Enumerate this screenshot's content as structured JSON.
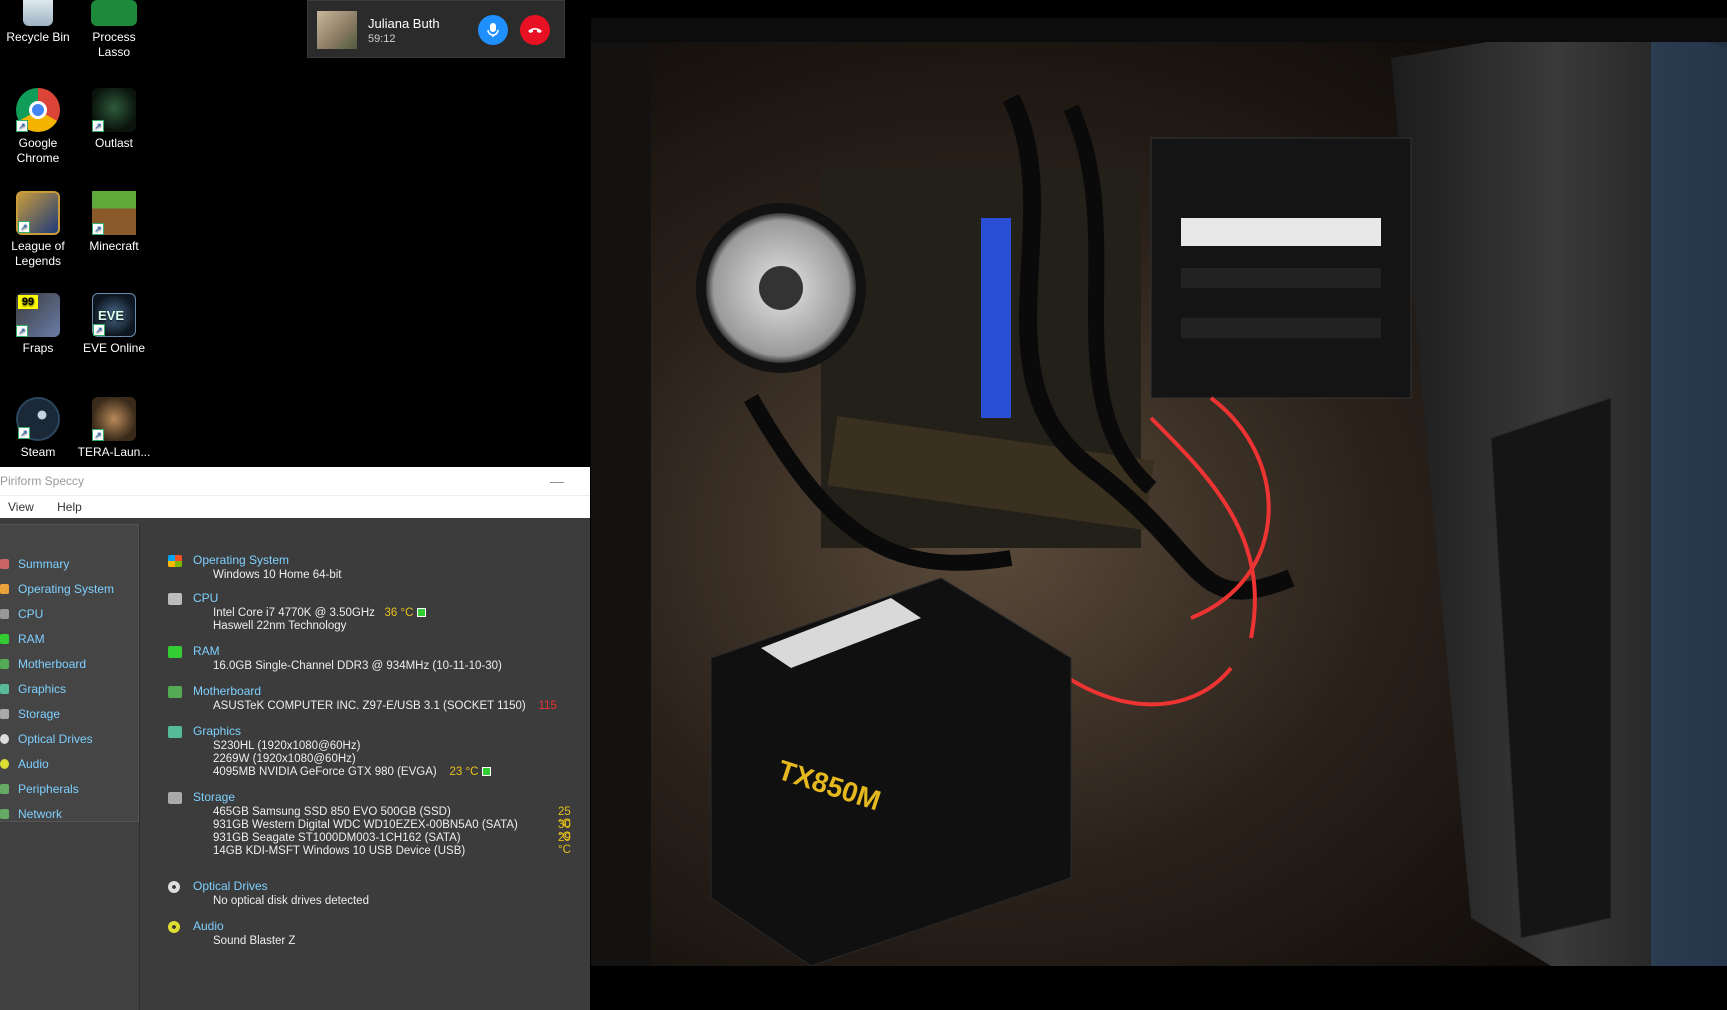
{
  "desktop": {
    "icons": [
      {
        "label": "Recycle Bin"
      },
      {
        "label": "Process Lasso"
      },
      {
        "label": "Google Chrome"
      },
      {
        "label": "Outlast"
      },
      {
        "label": "League of Legends"
      },
      {
        "label": "Minecraft"
      },
      {
        "label": "Fraps"
      },
      {
        "label": "EVE Online"
      },
      {
        "label": "Steam"
      },
      {
        "label": "TERA-Laun..."
      }
    ]
  },
  "call": {
    "name": "Juliana Buth",
    "duration": "59:12"
  },
  "speccy": {
    "title": "Piriform Speccy",
    "menu": [
      "View",
      "Help"
    ],
    "nav": [
      "Summary",
      "Operating System",
      "CPU",
      "RAM",
      "Motherboard",
      "Graphics",
      "Storage",
      "Optical Drives",
      "Audio",
      "Peripherals",
      "Network"
    ],
    "sections": {
      "os": {
        "title": "Operating System",
        "lines": [
          "Windows 10 Home 64-bit"
        ]
      },
      "cpu": {
        "title": "CPU",
        "lines": [
          "Intel Core i7 4770K @ 3.50GHz",
          "Haswell 22nm Technology"
        ],
        "temp": "36 °C"
      },
      "ram": {
        "title": "RAM",
        "lines": [
          "16.0GB Single-Channel DDR3 @ 934MHz (10-11-10-30)"
        ]
      },
      "mobo": {
        "title": "Motherboard",
        "lines": [
          "ASUSTeK COMPUTER INC. Z97-E/USB 3.1 (SOCKET 1150)"
        ],
        "temp": "115"
      },
      "graphics": {
        "title": "Graphics",
        "lines": [
          "S230HL (1920x1080@60Hz)",
          "2269W (1920x1080@60Hz)",
          "4095MB NVIDIA GeForce GTX 980 (EVGA)"
        ],
        "temp": "23 °C"
      },
      "storage": {
        "title": "Storage",
        "lines": [
          "465GB Samsung SSD 850 EVO 500GB (SSD)",
          "931GB Western Digital WDC WD10EZEX-00BN5A0 (SATA)",
          "931GB Seagate ST1000DM003-1CH162 (SATA)",
          "14GB KDI-MSFT Windows 10 USB Device (USB)"
        ],
        "temps": [
          "25 °C",
          "30 °C",
          "29 °C"
        ]
      },
      "optical": {
        "title": "Optical Drives",
        "lines": [
          "No optical disk drives detected"
        ]
      },
      "audio": {
        "title": "Audio",
        "lines": [
          "Sound Blaster Z"
        ]
      }
    }
  },
  "colors": {
    "accent": "#7fd0ff",
    "temp_ok": "#e8c21a",
    "temp_hot": "#e33333",
    "mic_button": "#1e90ff",
    "hangup_button": "#e81123"
  }
}
